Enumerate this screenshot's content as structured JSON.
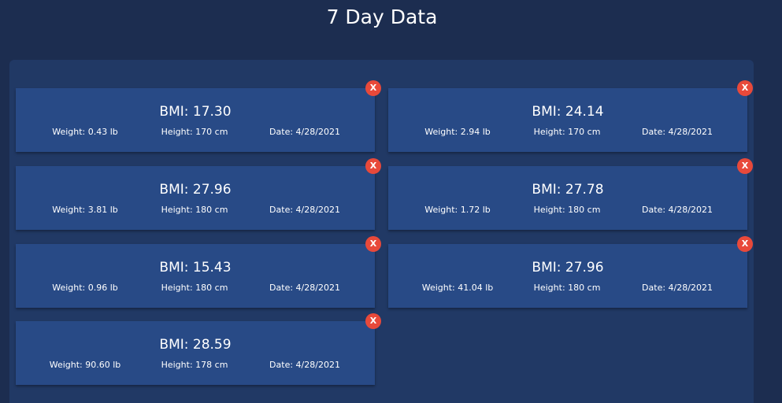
{
  "header": {
    "title": "7 Day Data"
  },
  "theme": {
    "background": "#1c2d50",
    "panel": "#213965",
    "card": "#284a86",
    "delete_button": "#e8493a"
  },
  "delete_icon": "close-icon",
  "delete_label": "X",
  "entries": [
    {
      "bmi": "BMI: 17.30",
      "weight": "Weight: 0.43 lb",
      "height": "Height: 170 cm",
      "date": "Date: 4/28/2021"
    },
    {
      "bmi": "BMI: 24.14",
      "weight": "Weight: 2.94 lb",
      "height": "Height: 170 cm",
      "date": "Date: 4/28/2021"
    },
    {
      "bmi": "BMI: 27.96",
      "weight": "Weight: 3.81 lb",
      "height": "Height: 180 cm",
      "date": "Date: 4/28/2021"
    },
    {
      "bmi": "BMI: 27.78",
      "weight": "Weight: 1.72 lb",
      "height": "Height: 180 cm",
      "date": "Date: 4/28/2021"
    },
    {
      "bmi": "BMI: 15.43",
      "weight": "Weight: 0.96 lb",
      "height": "Height: 180 cm",
      "date": "Date: 4/28/2021"
    },
    {
      "bmi": "BMI: 27.96",
      "weight": "Weight: 41.04 lb",
      "height": "Height: 180 cm",
      "date": "Date: 4/28/2021"
    },
    {
      "bmi": "BMI: 28.59",
      "weight": "Weight: 90.60 lb",
      "height": "Height: 178 cm",
      "date": "Date: 4/28/2021"
    }
  ]
}
